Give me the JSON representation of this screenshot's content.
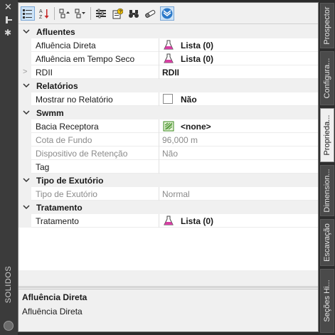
{
  "left_strip": {
    "title": "SOLIDOS",
    "close_glyph": "✕",
    "gear_glyph": "✱"
  },
  "toolbar": {
    "buttons": [
      {
        "name": "categorized-view-icon",
        "active": true
      },
      {
        "name": "alphabetical-sort-icon"
      },
      {
        "name": "expand-all-icon"
      },
      {
        "name": "collapse-all-icon"
      },
      {
        "name": "property-pages-icon"
      },
      {
        "name": "help-properties-icon"
      },
      {
        "name": "binoculars-icon"
      },
      {
        "name": "eraser-icon"
      },
      {
        "name": "autodesk-logo-icon",
        "active": true
      }
    ]
  },
  "grid": {
    "categories": [
      {
        "label": "Afluentes"
      },
      {
        "label": "Relatórios"
      },
      {
        "label": "Swmm"
      },
      {
        "label": "Tipo de Exutório"
      },
      {
        "label": "Tratamento"
      }
    ],
    "rows": {
      "afluencia_direta": {
        "name": "Afluência Direta",
        "value": "Lista (0)"
      },
      "afluencia_seco": {
        "name": "Afluência em Tempo Seco",
        "value": "Lista (0)"
      },
      "rdii": {
        "name": "RDII",
        "value": "RDII"
      },
      "mostrar_relatorio": {
        "name": "Mostrar no Relatório",
        "value": "Não"
      },
      "bacia_receptora": {
        "name": "Bacia Receptora",
        "value": "<none>"
      },
      "cota_fundo": {
        "name": "Cota de Fundo",
        "value": "96,000 m"
      },
      "dispositivo_retencao": {
        "name": "Dispositivo de Retenção",
        "value": "Não"
      },
      "tag": {
        "name": "Tag",
        "value": ""
      },
      "tipo_exutorio": {
        "name": "Tipo de Exutório",
        "value": "Normal"
      },
      "tratamento": {
        "name": "Tratamento",
        "value": "Lista (0)"
      }
    },
    "expander_glyph": ">"
  },
  "description": {
    "title": "Afluência Direta",
    "text": "Afluência Direta"
  },
  "right_tabs": [
    {
      "label": "Prospector"
    },
    {
      "label": "Configura..."
    },
    {
      "label": "Proprieda...",
      "active": true
    },
    {
      "label": "Dimension..."
    },
    {
      "label": "Escavação"
    },
    {
      "label": "Seções Hi..."
    }
  ],
  "colors": {
    "flask": "#d63fa3",
    "accent_blue": "#2b79c9",
    "panel_bg": "#f0f0f0",
    "dark_bg": "#2b2b2b"
  }
}
